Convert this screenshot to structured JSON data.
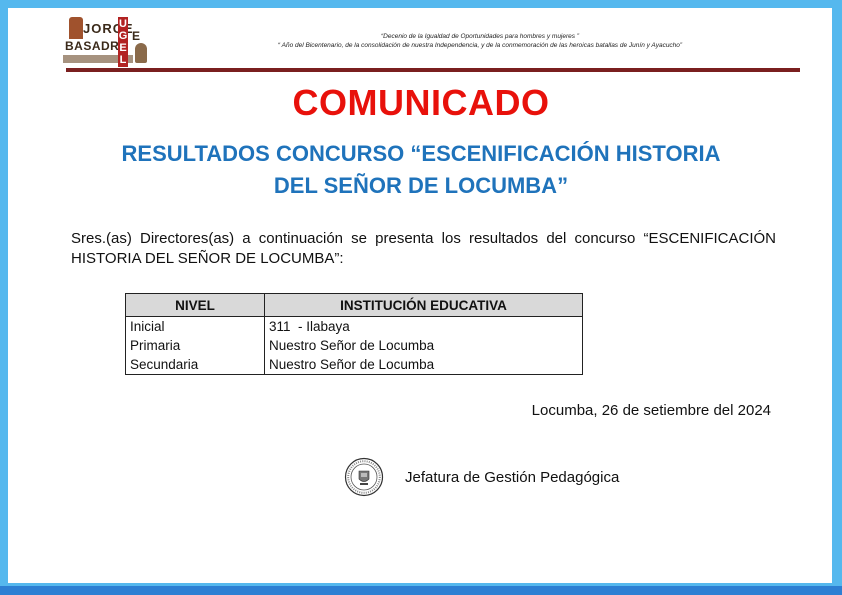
{
  "logo": {
    "line1": "JORGE",
    "line2": "BASADRE",
    "ugel": "UGEL",
    "e": "E"
  },
  "header": {
    "line1": "“Decenio de la Igualdad de Oportunidades para hombres y mujeres ”",
    "line2": "“ Año del Bicentenario, de la consolidación de nuestra Independencia, y de la conmemoración de las heroicas batallas de Junín y Ayacucho”"
  },
  "document": {
    "title": "COMUNICADO",
    "subtitle_line1": "RESULTADOS CONCURSO “ESCENIFICACIÓN HISTORIA",
    "subtitle_line2": "DEL SEÑOR DE LOCUMBA”",
    "intro": "Sres.(as) Directores(as) a continuación se presenta los resultados del concurso “ESCENIFICACIÓN HISTORIA DEL SEÑOR DE LOCUMBA”:",
    "date": "Locumba, 26 de setiembre del 2024",
    "signature": "Jefatura de Gestión Pedagógica"
  },
  "table": {
    "headers": [
      "NIVEL",
      "INSTITUCIÓN EDUCATIVA"
    ],
    "rows": [
      [
        "Inicial",
        "311  - Ilabaya"
      ],
      [
        "Primaria",
        "Nuestro Señor de Locumba"
      ],
      [
        "Secundaria",
        "Nuestro Señor de Locumba"
      ]
    ]
  },
  "colors": {
    "frame": "#55b8ee",
    "title": "#e8110b",
    "subtitle": "#1f73bb",
    "rule": "#7a1f1f",
    "table_header_bg": "#d9d9d9"
  }
}
